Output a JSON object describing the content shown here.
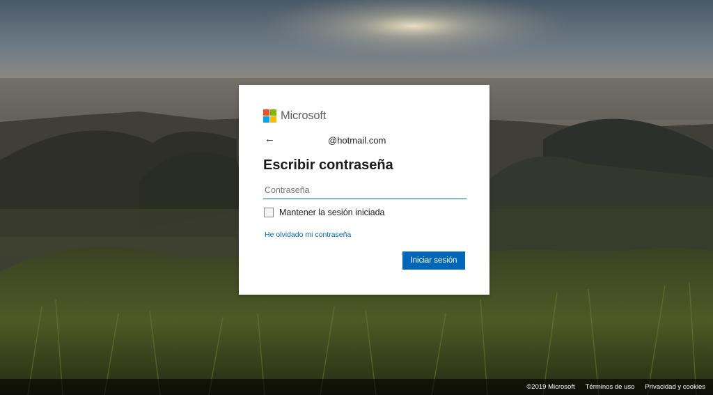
{
  "brand": {
    "name": "Microsoft",
    "logo_colors": [
      "#f25022",
      "#7fba00",
      "#00a4ef",
      "#ffb900"
    ]
  },
  "login": {
    "back_icon": "arrow-left-icon",
    "identity": "@hotmail.com",
    "title": "Escribir contraseña",
    "password_placeholder": "Contraseña",
    "password_value": "",
    "keep_signed_in_label": "Mantener la sesión iniciada",
    "keep_signed_in_checked": false,
    "forgot_password": "He olvidado mi contraseña",
    "submit_label": "Iniciar sesión"
  },
  "footer": {
    "copyright": "©2019 Microsoft",
    "terms": "Términos de uso",
    "privacy": "Privacidad y cookies"
  },
  "colors": {
    "accent": "#0067b8",
    "card": "#ffffff",
    "text": "#1b1b1b"
  }
}
